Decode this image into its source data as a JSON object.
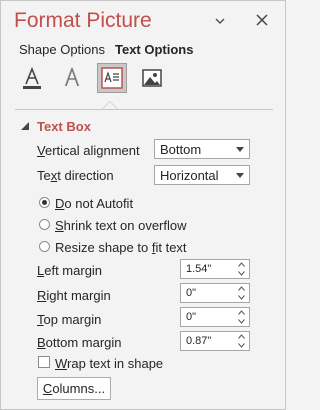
{
  "pane": {
    "title": "Format Picture",
    "tabs": [
      {
        "label": "Shape Options",
        "active": false
      },
      {
        "label": "Text Options",
        "active": true
      }
    ],
    "icon_tabs": [
      {
        "icon": "text-fill-outline-icon",
        "selected": false
      },
      {
        "icon": "text-effects-icon",
        "selected": false
      },
      {
        "icon": "textbox-icon",
        "selected": true
      },
      {
        "icon": "picture-icon",
        "selected": false
      }
    ]
  },
  "section": {
    "title": "Text Box",
    "vertical_alignment": {
      "label_u": "V",
      "label_rest": "ertical alignment",
      "value": "Bottom"
    },
    "text_direction": {
      "label_pre": "Te",
      "label_u": "x",
      "label_rest": "t direction",
      "value": "Horizontal"
    },
    "autofit": [
      {
        "label_u": "D",
        "label_rest": "o not Autofit",
        "checked": true
      },
      {
        "label_u": "S",
        "label_rest": "hrink text on overflow",
        "checked": false
      },
      {
        "label_pre": "Resize shape to ",
        "label_u": "f",
        "label_rest": "it text",
        "checked": false
      }
    ],
    "margins": [
      {
        "label_u": "L",
        "label_rest": "eft margin",
        "value": "1.54\""
      },
      {
        "label_u": "R",
        "label_rest": "ight margin",
        "value": "0\""
      },
      {
        "label_u": "T",
        "label_rest": "op margin",
        "value": "0\""
      },
      {
        "label_u": "B",
        "label_rest": "ottom margin",
        "value": "0.87\""
      }
    ],
    "wrap": {
      "label_u": "W",
      "label_rest": "rap text in shape",
      "checked": false
    },
    "columns_button": {
      "label_u": "C",
      "label_rest": "olumns..."
    }
  },
  "colors": {
    "accent": "#c0504d",
    "background": "#f3f3f3"
  }
}
